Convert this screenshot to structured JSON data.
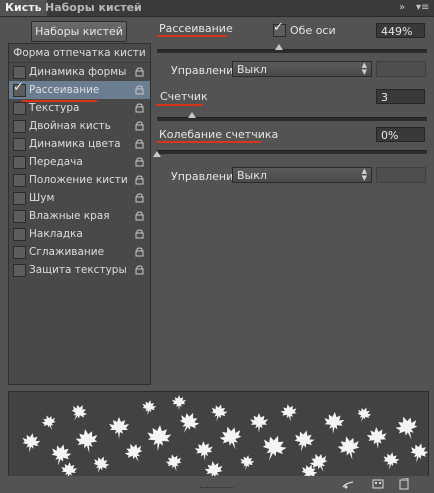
{
  "tabs": {
    "brush": "Кисть",
    "brush_presets": "Наборы кистей"
  },
  "tab_controls": {
    "collapse": ">>",
    "menu": "▾≡"
  },
  "presets_button": "Наборы кистей",
  "left_panel": {
    "header": "Форма отпечатка кисти",
    "items": [
      {
        "label": "Динамика формы",
        "checked": false,
        "selected": false
      },
      {
        "label": "Рассеивание",
        "checked": true,
        "selected": true
      },
      {
        "label": "Текстура",
        "checked": false,
        "selected": false
      },
      {
        "label": "Двойная кисть",
        "checked": false,
        "selected": false
      },
      {
        "label": "Динамика цвета",
        "checked": false,
        "selected": false
      },
      {
        "label": "Передача",
        "checked": false,
        "selected": false
      },
      {
        "label": "Положение кисти",
        "checked": false,
        "selected": false
      },
      {
        "label": "Шум",
        "checked": false,
        "selected": false
      },
      {
        "label": "Влажные края",
        "checked": false,
        "selected": false
      },
      {
        "label": "Накладка",
        "checked": false,
        "selected": false
      },
      {
        "label": "Сглаживание",
        "checked": false,
        "selected": false
      },
      {
        "label": "Защита текстуры",
        "checked": false,
        "selected": false
      }
    ]
  },
  "settings": {
    "scatter": {
      "label": "Рассеивание",
      "both_axes_label": "Обе оси",
      "both_axes_checked": true,
      "value": "449%",
      "slider_fraction": 0.45
    },
    "control_1": {
      "label": "Управление:",
      "value": "Выкл"
    },
    "count": {
      "label": "Счетчик",
      "value": "3",
      "slider_fraction": 0.13
    },
    "count_jitter": {
      "label": "Колебание счетчика",
      "value": "0%",
      "slider_fraction": 0.0
    },
    "control_2": {
      "label": "Управление:",
      "value": "Выкл"
    }
  },
  "colors": {
    "accent_red": "#d8351a",
    "selection": "#6b7d90",
    "panel_bg": "#535353"
  }
}
